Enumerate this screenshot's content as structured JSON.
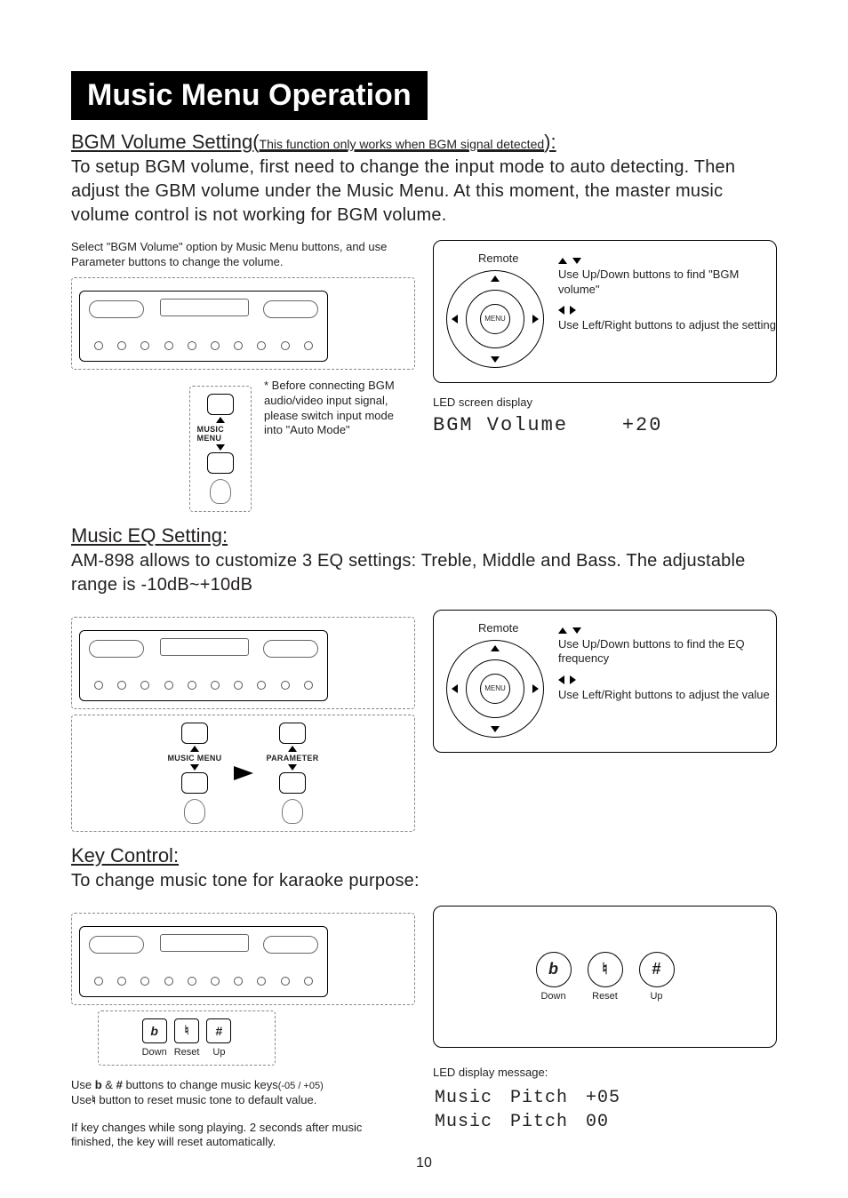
{
  "title": "Music Menu Operation",
  "page_number": "10",
  "bgm": {
    "heading_main": "BGM Volume Setting",
    "heading_note": "This function only works when BGM signal detected",
    "heading_colon": ":",
    "body": "To setup BGM volume, first need to change the input mode to auto detecting. Then adjust the GBM volume under the Music Menu. At this moment, the master music volume control is not working for BGM volume.",
    "left_caption": "Select \"BGM Volume\" option by Music Menu buttons, and use Parameter buttons to change the volume.",
    "music_menu_label": "MUSIC MENU",
    "footnote": "* Before connecting BGM audio/video input signal, please switch input mode into \"Auto Mode\"",
    "remote_label": "Remote",
    "remote_center": "MENU",
    "remote_hint1": "Use Up/Down buttons to find \"BGM volume\"",
    "remote_hint2": "Use Left/Right buttons to adjust the setting",
    "led_caption": "LED screen display",
    "led_value_label": "BGM Volume",
    "led_value_num": "+20"
  },
  "eq": {
    "heading": "Music EQ Setting:",
    "body": "AM-898 allows to customize 3 EQ settings: Treble, Middle and Bass. The adjustable range is -10dB~+10dB",
    "music_menu_label": "MUSIC MENU",
    "parameter_label": "PARAMETER",
    "remote_label": "Remote",
    "remote_center": "MENU",
    "remote_hint1": "Use Up/Down buttons to find the EQ frequency",
    "remote_hint2": "Use Left/Right buttons to adjust the value"
  },
  "key": {
    "heading": "Key Control:",
    "body": "To change music tone for karaoke purpose:",
    "btn_down_sym": "b",
    "btn_reset_sym": "♮",
    "btn_up_sym": "#",
    "btn_down_label": "Down",
    "btn_reset_label": "Reset",
    "btn_up_label": "Up",
    "note_line1_a": "Use ",
    "note_line1_b": " & ",
    "note_line1_c": " buttons to change music keys",
    "note_line1_range": "(-05 / +05)",
    "note_line2_a": "Use",
    "note_line2_b": " button to reset music tone to default value.",
    "note_para2": "If key changes while song playing. 2 seconds after music finished, the key will reset automatically.",
    "led_caption": "LED display message:",
    "led_rows": [
      {
        "a": "Music",
        "b": "Pitch",
        "c": "+05"
      },
      {
        "a": "Music",
        "b": "Pitch",
        "c": "00"
      }
    ]
  }
}
